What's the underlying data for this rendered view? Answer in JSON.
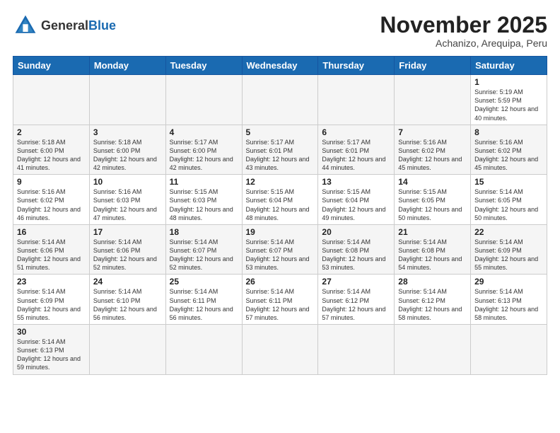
{
  "header": {
    "logo_general": "General",
    "logo_blue": "Blue",
    "month_title": "November 2025",
    "subtitle": "Achanizo, Arequipa, Peru"
  },
  "days_of_week": [
    "Sunday",
    "Monday",
    "Tuesday",
    "Wednesday",
    "Thursday",
    "Friday",
    "Saturday"
  ],
  "weeks": [
    {
      "days": [
        {
          "num": "",
          "info": ""
        },
        {
          "num": "",
          "info": ""
        },
        {
          "num": "",
          "info": ""
        },
        {
          "num": "",
          "info": ""
        },
        {
          "num": "",
          "info": ""
        },
        {
          "num": "",
          "info": ""
        },
        {
          "num": "1",
          "info": "Sunrise: 5:19 AM\nSunset: 5:59 PM\nDaylight: 12 hours and 40 minutes."
        }
      ]
    },
    {
      "days": [
        {
          "num": "2",
          "info": "Sunrise: 5:18 AM\nSunset: 6:00 PM\nDaylight: 12 hours and 41 minutes."
        },
        {
          "num": "3",
          "info": "Sunrise: 5:18 AM\nSunset: 6:00 PM\nDaylight: 12 hours and 42 minutes."
        },
        {
          "num": "4",
          "info": "Sunrise: 5:17 AM\nSunset: 6:00 PM\nDaylight: 12 hours and 42 minutes."
        },
        {
          "num": "5",
          "info": "Sunrise: 5:17 AM\nSunset: 6:01 PM\nDaylight: 12 hours and 43 minutes."
        },
        {
          "num": "6",
          "info": "Sunrise: 5:17 AM\nSunset: 6:01 PM\nDaylight: 12 hours and 44 minutes."
        },
        {
          "num": "7",
          "info": "Sunrise: 5:16 AM\nSunset: 6:02 PM\nDaylight: 12 hours and 45 minutes."
        },
        {
          "num": "8",
          "info": "Sunrise: 5:16 AM\nSunset: 6:02 PM\nDaylight: 12 hours and 45 minutes."
        }
      ]
    },
    {
      "days": [
        {
          "num": "9",
          "info": "Sunrise: 5:16 AM\nSunset: 6:02 PM\nDaylight: 12 hours and 46 minutes."
        },
        {
          "num": "10",
          "info": "Sunrise: 5:16 AM\nSunset: 6:03 PM\nDaylight: 12 hours and 47 minutes."
        },
        {
          "num": "11",
          "info": "Sunrise: 5:15 AM\nSunset: 6:03 PM\nDaylight: 12 hours and 48 minutes."
        },
        {
          "num": "12",
          "info": "Sunrise: 5:15 AM\nSunset: 6:04 PM\nDaylight: 12 hours and 48 minutes."
        },
        {
          "num": "13",
          "info": "Sunrise: 5:15 AM\nSunset: 6:04 PM\nDaylight: 12 hours and 49 minutes."
        },
        {
          "num": "14",
          "info": "Sunrise: 5:15 AM\nSunset: 6:05 PM\nDaylight: 12 hours and 50 minutes."
        },
        {
          "num": "15",
          "info": "Sunrise: 5:14 AM\nSunset: 6:05 PM\nDaylight: 12 hours and 50 minutes."
        }
      ]
    },
    {
      "days": [
        {
          "num": "16",
          "info": "Sunrise: 5:14 AM\nSunset: 6:06 PM\nDaylight: 12 hours and 51 minutes."
        },
        {
          "num": "17",
          "info": "Sunrise: 5:14 AM\nSunset: 6:06 PM\nDaylight: 12 hours and 52 minutes."
        },
        {
          "num": "18",
          "info": "Sunrise: 5:14 AM\nSunset: 6:07 PM\nDaylight: 12 hours and 52 minutes."
        },
        {
          "num": "19",
          "info": "Sunrise: 5:14 AM\nSunset: 6:07 PM\nDaylight: 12 hours and 53 minutes."
        },
        {
          "num": "20",
          "info": "Sunrise: 5:14 AM\nSunset: 6:08 PM\nDaylight: 12 hours and 53 minutes."
        },
        {
          "num": "21",
          "info": "Sunrise: 5:14 AM\nSunset: 6:08 PM\nDaylight: 12 hours and 54 minutes."
        },
        {
          "num": "22",
          "info": "Sunrise: 5:14 AM\nSunset: 6:09 PM\nDaylight: 12 hours and 55 minutes."
        }
      ]
    },
    {
      "days": [
        {
          "num": "23",
          "info": "Sunrise: 5:14 AM\nSunset: 6:09 PM\nDaylight: 12 hours and 55 minutes."
        },
        {
          "num": "24",
          "info": "Sunrise: 5:14 AM\nSunset: 6:10 PM\nDaylight: 12 hours and 56 minutes."
        },
        {
          "num": "25",
          "info": "Sunrise: 5:14 AM\nSunset: 6:11 PM\nDaylight: 12 hours and 56 minutes."
        },
        {
          "num": "26",
          "info": "Sunrise: 5:14 AM\nSunset: 6:11 PM\nDaylight: 12 hours and 57 minutes."
        },
        {
          "num": "27",
          "info": "Sunrise: 5:14 AM\nSunset: 6:12 PM\nDaylight: 12 hours and 57 minutes."
        },
        {
          "num": "28",
          "info": "Sunrise: 5:14 AM\nSunset: 6:12 PM\nDaylight: 12 hours and 58 minutes."
        },
        {
          "num": "29",
          "info": "Sunrise: 5:14 AM\nSunset: 6:13 PM\nDaylight: 12 hours and 58 minutes."
        }
      ]
    },
    {
      "days": [
        {
          "num": "30",
          "info": "Sunrise: 5:14 AM\nSunset: 6:13 PM\nDaylight: 12 hours and 59 minutes."
        },
        {
          "num": "",
          "info": ""
        },
        {
          "num": "",
          "info": ""
        },
        {
          "num": "",
          "info": ""
        },
        {
          "num": "",
          "info": ""
        },
        {
          "num": "",
          "info": ""
        },
        {
          "num": "",
          "info": ""
        }
      ]
    }
  ]
}
